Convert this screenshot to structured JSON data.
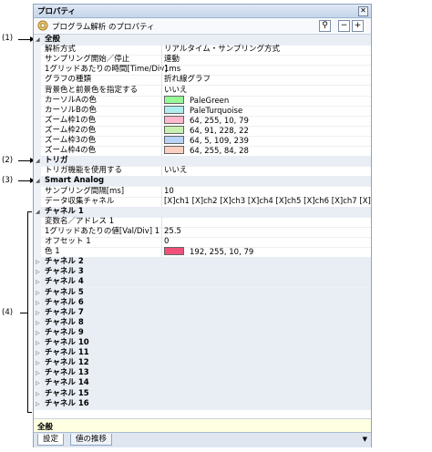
{
  "window": {
    "title": "プロパティ",
    "toolbar_label": "プログラム解析 のプロパティ"
  },
  "annotations": [
    "(1)",
    "(2)",
    "(3)",
    "(4)"
  ],
  "rows": [
    {
      "type": "cat",
      "name": "全般",
      "expander": "◢"
    },
    {
      "name": "解析方式",
      "value": "リアルタイム・サンプリング方式"
    },
    {
      "name": "サンプリング開始／停止",
      "value": "連動"
    },
    {
      "name": "1グリッドあたりの時間[Time/Div]",
      "value": "1ms"
    },
    {
      "name": "グラフの種類",
      "value": "折れ線グラフ"
    },
    {
      "name": "背景色と前景色を指定する",
      "value": "いいえ"
    },
    {
      "name": "カーソルAの色",
      "value": "PaleGreen",
      "color": "#98fb98"
    },
    {
      "name": "カーソルBの色",
      "value": "PaleTurquoise",
      "color": "#afeeee"
    },
    {
      "name": "ズーム枠1の色",
      "value": "64, 255, 10, 79",
      "color": "#ffb8cc"
    },
    {
      "name": "ズーム枠2の色",
      "value": "64, 91, 228, 22",
      "color": "#c8f0b0"
    },
    {
      "name": "ズーム枠3の色",
      "value": "64, 5, 109, 239",
      "color": "#b8d4f8"
    },
    {
      "name": "ズーム枠4の色",
      "value": "64, 255, 84, 28",
      "color": "#fcd0c0"
    },
    {
      "type": "cat",
      "name": "トリガ",
      "expander": "◢"
    },
    {
      "name": "トリガ機能を使用する",
      "value": "いいえ"
    },
    {
      "type": "cat",
      "name": "Smart Analog",
      "expander": "◢"
    },
    {
      "name": "サンプリング間隔[ms]",
      "value": "10"
    },
    {
      "name": "データ収集チャネル",
      "value": "[X]ch1 [X]ch2 [X]ch3 [X]ch4 [X]ch5 [X]ch6 [X]ch7 [X]ch8"
    },
    {
      "type": "cat",
      "name": "チャネル 1",
      "expander": "◢"
    },
    {
      "name": "変数名／アドレス 1",
      "value": ""
    },
    {
      "name": "1グリッドあたりの値[Val/Div] 1",
      "value": "25.5"
    },
    {
      "name": "オフセット 1",
      "value": "0"
    },
    {
      "name": "色 1",
      "value": "192, 255, 10, 79",
      "color": "#f0507a"
    },
    {
      "type": "cat",
      "name": "チャネル 2",
      "expander": "▷"
    },
    {
      "type": "cat",
      "name": "チャネル 3",
      "expander": "▷"
    },
    {
      "type": "cat",
      "name": "チャネル 4",
      "expander": "▷"
    },
    {
      "type": "cat",
      "name": "チャネル 5",
      "expander": "▷"
    },
    {
      "type": "cat",
      "name": "チャネル 6",
      "expander": "▷"
    },
    {
      "type": "cat",
      "name": "チャネル 7",
      "expander": "▷"
    },
    {
      "type": "cat",
      "name": "チャネル 8",
      "expander": "▷"
    },
    {
      "type": "cat",
      "name": "チャネル 9",
      "expander": "▷"
    },
    {
      "type": "cat",
      "name": "チャネル 10",
      "expander": "▷"
    },
    {
      "type": "cat",
      "name": "チャネル 11",
      "expander": "▷"
    },
    {
      "type": "cat",
      "name": "チャネル 12",
      "expander": "▷"
    },
    {
      "type": "cat",
      "name": "チャネル 13",
      "expander": "▷"
    },
    {
      "type": "cat",
      "name": "チャネル 14",
      "expander": "▷"
    },
    {
      "type": "cat",
      "name": "チャネル 15",
      "expander": "▷"
    },
    {
      "type": "cat",
      "name": "チャネル 16",
      "expander": "▷"
    }
  ],
  "description": "全般",
  "tabs": [
    "設定",
    "値の推移"
  ]
}
